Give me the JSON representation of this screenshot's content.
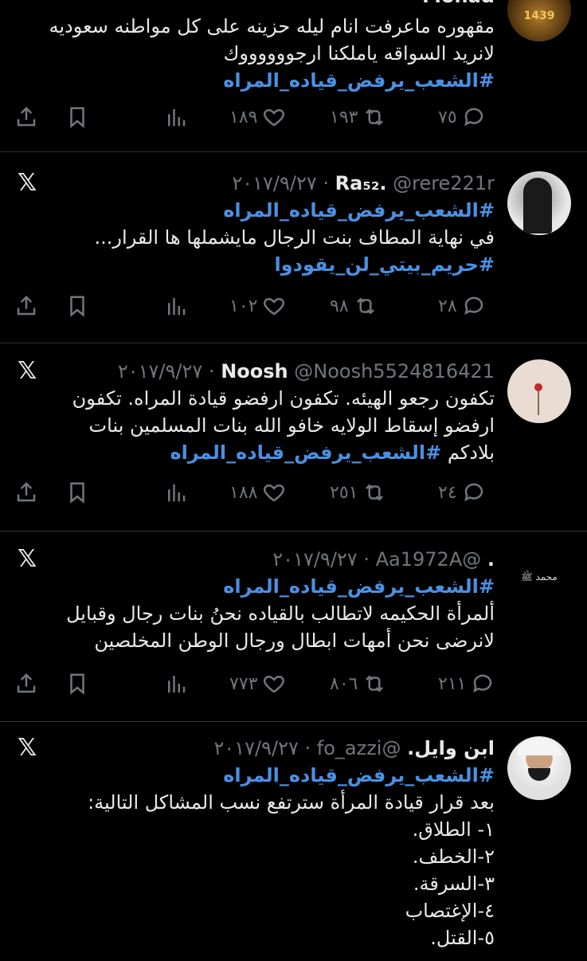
{
  "tweets": [
    {
      "name": "Mohad",
      "handle": "",
      "date": "",
      "lines": [
        "مقهوره ماعرفت انام ليله حزينه على كل مواطنه سعوديه",
        "لانريد السواقه ياملكنا ارجووووووك"
      ],
      "hashtags": [
        "#الشعب_يرفض_قياده_المراه"
      ],
      "replies": "٧٥",
      "retweets": "١٩٣",
      "likes": "١٨٩",
      "avatar_text": "1439"
    },
    {
      "name": "Ra₅₂.",
      "handle": "@rere221r",
      "date": "٢٠١٧/٩/٢٧",
      "hashtags_top": [
        "#الشعب_يرفض_قياده_المراه"
      ],
      "lines": [
        "في نهاية المطاف بنت الرجال مايشملها ها القرار..."
      ],
      "hashtags": [
        "#حريم_بيتي_لن_يقودوا"
      ],
      "replies": "٢٨",
      "retweets": "٩٨",
      "likes": "١٠٢"
    },
    {
      "name": "Noosh",
      "handle": "@Noosh5524816421",
      "date": "٢٠١٧/٩/٢٧",
      "lines": [
        "تكفون رجعو الهيئه. تكفون ارفضو قيادة المراه. تكفون",
        "ارفضو إسقاط الولايه خافو الله بنات المسلمين بنات"
      ],
      "last_text": "بلادكم",
      "last_hashtag": "#الشعب_يرفض_قياده_المراه",
      "replies": "٢٤",
      "retweets": "٢٥١",
      "likes": "١٨٨"
    },
    {
      "name": ".",
      "handle": "@Aa1972A",
      "date": "٢٠١٧/٩/٢٧",
      "hashtags_top": [
        "#الشعب_يرفض_قياده_المراه"
      ],
      "lines": [
        "ألمرأة الحكيمه لاتطالب بالقياده نحنُ بنات رجال وقبايل",
        "لانرضى نحن أمهات ابطال  ورجال الوطن المخلصين"
      ],
      "replies": "٢١١",
      "retweets": "٨٠٦",
      "likes": "٧٧٣",
      "avatar_text": "محمد ﷺ"
    },
    {
      "name": "ابن وايل.",
      "handle": "@fo_azzi",
      "date": "٢٠١٧/٩/٢٧",
      "hashtags_top": [
        "#الشعب_يرفض_قياده_المراه"
      ],
      "lines": [
        "بعد قرار قيادة المرأة سترتفع نسب المشاكل التالية:",
        "١- الطلاق.",
        "٢-الخطف.",
        "٣-السرقة.",
        "٤-الإغتصاب",
        "٥-القتل."
      ]
    }
  ],
  "ui": {
    "x_logo": "𝕏",
    "dot": "·"
  },
  "colors": {
    "bg": "#000000",
    "text": "#e7e9ea",
    "muted": "#71767b",
    "link": "#4a90e2",
    "divider": "#2f3336"
  }
}
